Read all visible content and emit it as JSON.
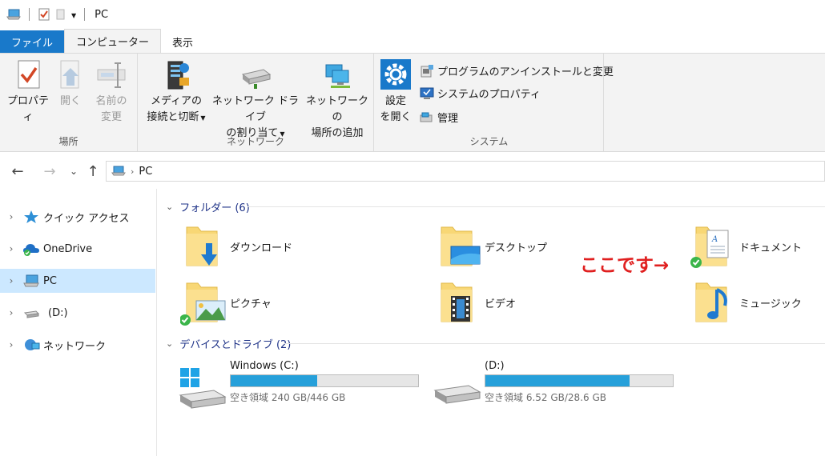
{
  "window": {
    "title": "PC"
  },
  "tabs": [
    {
      "label": "ファイル"
    },
    {
      "label": "コンピューター"
    },
    {
      "label": "表示"
    }
  ],
  "ribbon": {
    "location_group": {
      "label": "場所",
      "properties": "プロパティ",
      "open": "開く",
      "rename_line1": "名前の",
      "rename_line2": "変更"
    },
    "network_group": {
      "label": "ネットワーク",
      "media_line1": "メディアの",
      "media_line2": "接続と切断",
      "map_line1": "ネットワーク ドライブ",
      "map_line2": "の割り当て",
      "add_line1": "ネットワークの",
      "add_line2": "場所の追加"
    },
    "system_group": {
      "label": "システム",
      "settings_line1": "設定",
      "settings_line2": "を開く",
      "uninstall": "プログラムのアンインストールと変更",
      "sysprops": "システムのプロパティ",
      "manage": "管理"
    }
  },
  "address": {
    "path": "PC"
  },
  "nav": {
    "items": [
      {
        "label": "クイック アクセス"
      },
      {
        "label": "OneDrive"
      },
      {
        "label": "PC"
      },
      {
        "label": "(D:)"
      },
      {
        "label": "ネットワーク"
      }
    ]
  },
  "folders_section": {
    "title": "フォルダー (6)"
  },
  "folders": [
    {
      "name": "ダウンロード"
    },
    {
      "name": "デスクトップ"
    },
    {
      "name": "ドキュメント"
    },
    {
      "name": "ピクチャ"
    },
    {
      "name": "ビデオ"
    },
    {
      "name": "ミュージック"
    }
  ],
  "annotation": {
    "text": "ここです→"
  },
  "drives_section": {
    "title": "デバイスとドライブ (2)"
  },
  "drives": [
    {
      "name": "Windows (C:)",
      "space": "空き領域 240 GB/446 GB",
      "used_fraction": 0.46
    },
    {
      "name": "(D:)",
      "space": "空き領域 6.52 GB/28.6 GB",
      "used_fraction": 0.77
    }
  ],
  "colors": {
    "accent": "#1979ca",
    "selection": "#cce8ff",
    "bar": "#26a0da",
    "annotation": "#e02020"
  }
}
